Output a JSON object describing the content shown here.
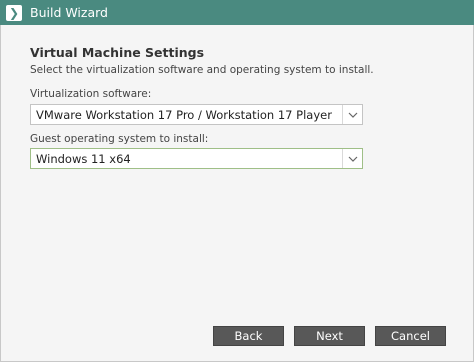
{
  "window": {
    "title": "Build Wizard",
    "icon": "chevron-right-icon"
  },
  "main": {
    "heading": "Virtual Machine Settings",
    "subtitle": "Select the virtualization software and operating system to install.",
    "virtualization": {
      "label": "Virtualization software:",
      "selected": "VMware Workstation 17 Pro / Workstation 17 Player"
    },
    "guest_os": {
      "label": "Guest operating system to install:",
      "selected": "Windows 11 x64"
    }
  },
  "footer": {
    "back_label": "Back",
    "next_label": "Next",
    "cancel_label": "Cancel"
  },
  "colors": {
    "titlebar": "#4a8a80",
    "button": "#585858",
    "focus_border": "#9fbf87"
  }
}
